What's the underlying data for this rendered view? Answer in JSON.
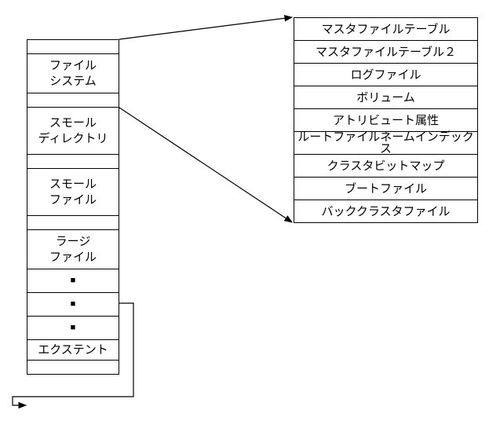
{
  "left_items": {
    "file_system_l1": "ファイル",
    "file_system_l2": "システム",
    "small_dir_l1": "スモール",
    "small_dir_l2": "ディレクトリ",
    "small_file_l1": "スモール",
    "small_file_l2": "ファイル",
    "large_file_l1": "ラージ",
    "large_file_l2": "ファイル",
    "dot": "■",
    "extent": "エクステント"
  },
  "right_items": {
    "r0": "マスタファイルテーブル",
    "r1": "マスタファイルテーブル２",
    "r2": "ログファイル",
    "r3": "ボリューム",
    "r4": "アトリビュート属性",
    "r5": "ルートファイルネームインデックス",
    "r6": "クラスタビットマップ",
    "r7": "ブートファイル",
    "r8": "バッククラスタファイル"
  }
}
